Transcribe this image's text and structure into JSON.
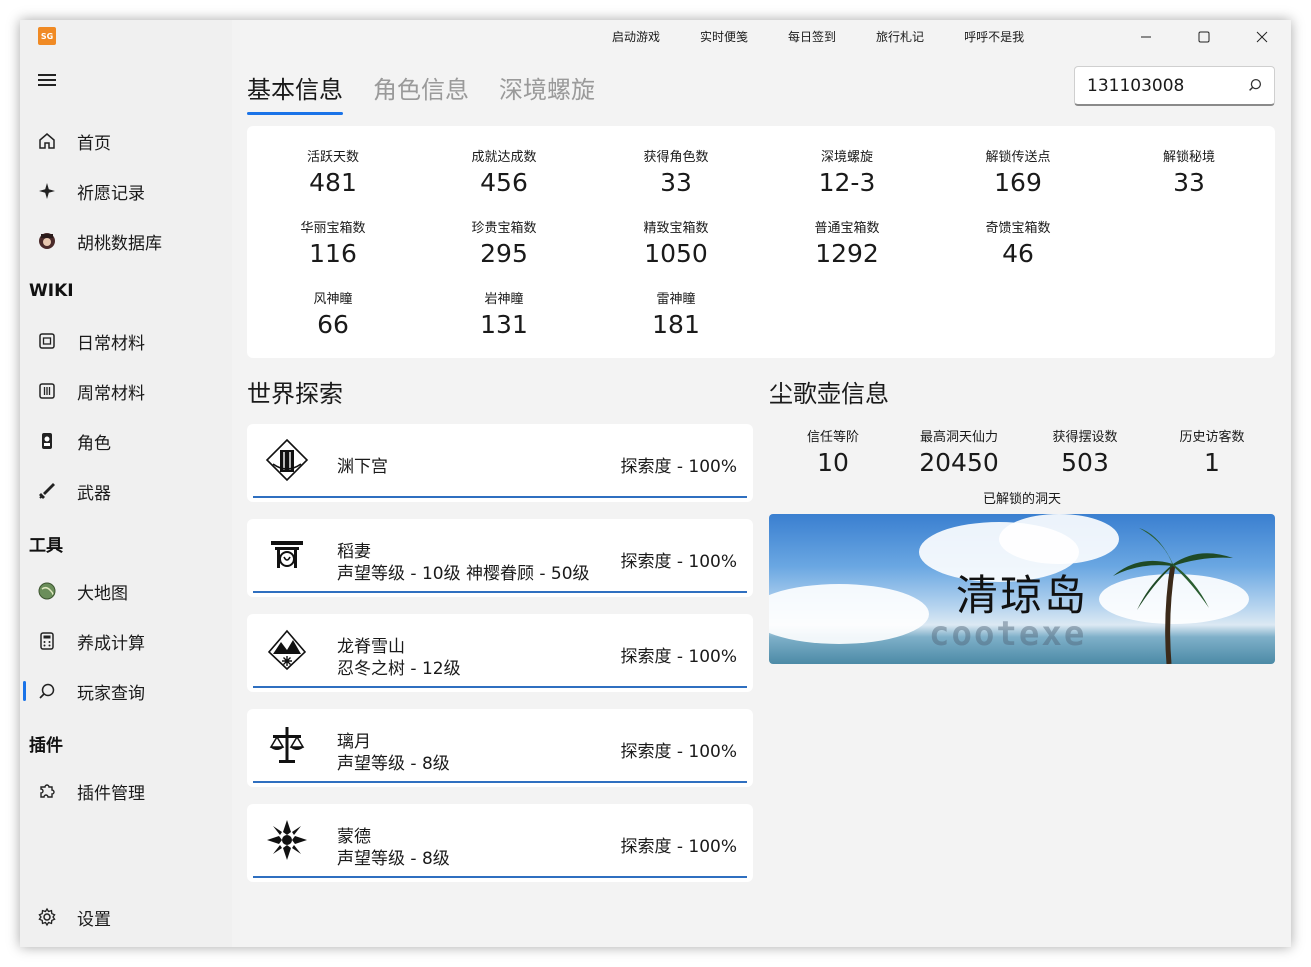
{
  "app": {
    "logo_text": "SG"
  },
  "sidebar": {
    "items": [
      {
        "label": "首页"
      },
      {
        "label": "祈愿记录"
      },
      {
        "label": "胡桃数据库"
      }
    ],
    "wiki_title": "WIKI",
    "wiki_items": [
      {
        "label": "日常材料"
      },
      {
        "label": "周常材料"
      },
      {
        "label": "角色"
      },
      {
        "label": "武器"
      }
    ],
    "tools_title": "工具",
    "tools_items": [
      {
        "label": "大地图"
      },
      {
        "label": "养成计算"
      },
      {
        "label": "玩家查询"
      }
    ],
    "plugins_title": "插件",
    "plugins_items": [
      {
        "label": "插件管理"
      }
    ],
    "settings_label": "设置"
  },
  "topmenu": [
    "启动游戏",
    "实时便笺",
    "每日签到",
    "旅行札记",
    "呼呼不是我"
  ],
  "tabs": [
    "基本信息",
    "角色信息",
    "深境螺旋"
  ],
  "search": {
    "value": "131103008"
  },
  "stats": [
    {
      "label": "活跃天数",
      "value": "481"
    },
    {
      "label": "成就达成数",
      "value": "456"
    },
    {
      "label": "获得角色数",
      "value": "33"
    },
    {
      "label": "深境螺旋",
      "value": "12-3"
    },
    {
      "label": "解锁传送点",
      "value": "169"
    },
    {
      "label": "解锁秘境",
      "value": "33"
    },
    {
      "label": "华丽宝箱数",
      "value": "116"
    },
    {
      "label": "珍贵宝箱数",
      "value": "295"
    },
    {
      "label": "精致宝箱数",
      "value": "1050"
    },
    {
      "label": "普通宝箱数",
      "value": "1292"
    },
    {
      "label": "奇馈宝箱数",
      "value": "46"
    },
    {
      "label": "风神瞳",
      "value": "66"
    },
    {
      "label": "岩神瞳",
      "value": "131"
    },
    {
      "label": "雷神瞳",
      "value": "181"
    }
  ],
  "world": {
    "title": "世界探索",
    "regions": [
      {
        "name": "渊下宫",
        "sub": "",
        "exploration": "探索度 - 100%"
      },
      {
        "name": "稻妻",
        "sub": "声望等级 - 10级  神樱眷顾 - 50级",
        "exploration": "探索度 - 100%"
      },
      {
        "name": "龙脊雪山",
        "sub": "忍冬之树 - 12级",
        "exploration": "探索度 - 100%"
      },
      {
        "name": "璃月",
        "sub": "声望等级 - 8级",
        "exploration": "探索度 - 100%"
      },
      {
        "name": "蒙德",
        "sub": "声望等级 - 8级",
        "exploration": "探索度 - 100%"
      }
    ]
  },
  "home": {
    "title": "尘歌壶信息",
    "stats": [
      {
        "label": "信任等阶",
        "value": "10"
      },
      {
        "label": "最高洞天仙力",
        "value": "20450"
      },
      {
        "label": "获得摆设数",
        "value": "503"
      },
      {
        "label": "历史访客数",
        "value": "1"
      }
    ],
    "realm_caption": "已解锁的洞天",
    "realm_name": "清琼岛",
    "watermark": "cootexe"
  }
}
